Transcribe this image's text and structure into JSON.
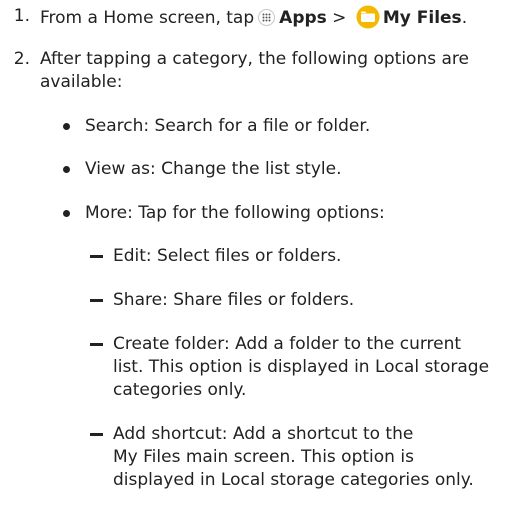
{
  "steps": [
    {
      "number": "1.",
      "text_before": "From a Home screen, tap",
      "apps_label": "Apps",
      "separator": " > ",
      "my_files_label": "My Files",
      "end": "."
    },
    {
      "number": "2.",
      "line1": "After tapping a category, the following options are",
      "line2": "available:"
    }
  ],
  "options": [
    {
      "label": "Search",
      "desc": ": Search for a file or folder."
    },
    {
      "label": "View as",
      "desc": ": Change the list style."
    },
    {
      "label": "More",
      "desc": ": Tap for the following options:"
    }
  ],
  "more_options": [
    {
      "label": "Edit",
      "desc": ": Select files or folders."
    },
    {
      "label": "Share",
      "desc": ": Share files or folders."
    },
    {
      "label": "Create folder",
      "desc": ": Add a folder to the current",
      "line2": "list. This option is displayed in Local storage",
      "line3": "categories only."
    },
    {
      "label": "Add shortcut",
      "desc": ": Add a shortcut to the",
      "line2": "My Files main screen. This option is",
      "line3": "displayed in Local storage categories only."
    }
  ],
  "icons": {
    "apps": "apps-icon",
    "my_files": "my-files-folder-icon"
  },
  "colors": {
    "text": "#222222",
    "folder_yellow": "#f5b800"
  }
}
